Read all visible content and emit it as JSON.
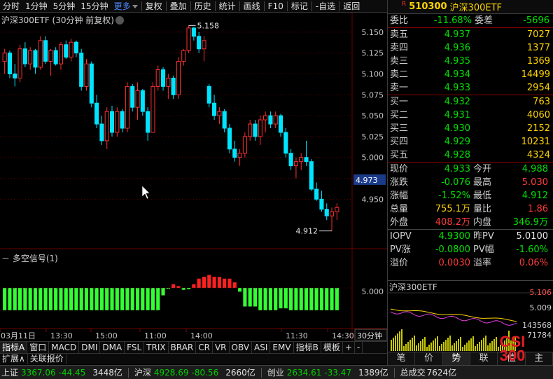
{
  "toolbar": {
    "items": [
      "分时",
      "1分钟",
      "5分钟",
      "15分钟",
      "更多",
      "复权",
      "叠加",
      "历史",
      "统计",
      "画线",
      "F10",
      "标记",
      "-自选",
      "返回"
    ]
  },
  "chart": {
    "title": "沪深300ETF (30分钟 前复权)",
    "y_ticks": [
      "5.150",
      "5.125",
      "5.100",
      "5.075",
      "5.050",
      "5.025",
      "5.000",
      "4.975",
      "4.950"
    ],
    "current_price_tag": "4.973",
    "high_annotation": "5.158",
    "low_annotation": "4.912",
    "x_ticks": [
      "03月11日",
      "13:30",
      "15:00",
      "11:00",
      "14:00",
      "11:30",
      "14:30"
    ],
    "period_label": "30分钟",
    "colors": {
      "up": "#ff3030",
      "down": "#00e5ff",
      "signal_up": "#ff2020",
      "signal_down": "#33ff33"
    }
  },
  "chart_data": {
    "type": "candlestick",
    "title": "沪深300ETF (30分钟 前复权)",
    "ylim": [
      4.905,
      5.165
    ],
    "candles": [
      [
        5.115,
        5.13,
        5.1,
        5.125
      ],
      [
        5.125,
        5.128,
        5.095,
        5.1
      ],
      [
        5.1,
        5.112,
        5.085,
        5.095
      ],
      [
        5.095,
        5.135,
        5.09,
        5.13
      ],
      [
        5.13,
        5.138,
        5.108,
        5.112
      ],
      [
        5.112,
        5.132,
        5.105,
        5.128
      ],
      [
        5.128,
        5.13,
        5.1,
        5.108
      ],
      [
        5.108,
        5.145,
        5.105,
        5.14
      ],
      [
        5.14,
        5.145,
        5.112,
        5.115
      ],
      [
        5.115,
        5.13,
        5.098,
        5.128
      ],
      [
        5.128,
        5.132,
        5.11,
        5.112
      ],
      [
        5.112,
        5.138,
        5.105,
        5.135
      ],
      [
        5.135,
        5.14,
        5.118,
        5.12
      ],
      [
        5.12,
        5.142,
        5.115,
        5.138
      ],
      [
        5.138,
        5.14,
        5.12,
        5.125
      ],
      [
        5.125,
        5.13,
        5.08,
        5.085
      ],
      [
        5.085,
        5.118,
        5.08,
        5.112
      ],
      [
        5.112,
        5.115,
        5.06,
        5.065
      ],
      [
        5.065,
        5.075,
        5.035,
        5.04
      ],
      [
        5.04,
        5.05,
        5.015,
        5.02
      ],
      [
        5.02,
        5.06,
        5.01,
        5.055
      ],
      [
        5.055,
        5.062,
        5.025,
        5.03
      ],
      [
        5.03,
        5.06,
        5.025,
        5.055
      ],
      [
        5.055,
        5.058,
        5.03,
        5.035
      ],
      [
        5.035,
        5.09,
        5.03,
        5.085
      ],
      [
        5.085,
        5.088,
        5.055,
        5.06
      ],
      [
        5.06,
        5.09,
        5.045,
        5.08
      ],
      [
        5.08,
        5.082,
        5.05,
        5.055
      ],
      [
        5.055,
        5.06,
        5.02,
        5.03
      ],
      [
        5.03,
        5.09,
        5.03,
        5.085
      ],
      [
        5.085,
        5.11,
        5.08,
        5.105
      ],
      [
        5.105,
        5.108,
        5.08,
        5.085
      ],
      [
        5.085,
        5.1,
        5.07,
        5.095
      ],
      [
        5.095,
        5.098,
        5.07,
        5.075
      ],
      [
        5.075,
        5.12,
        5.07,
        5.115
      ],
      [
        5.115,
        5.13,
        5.11,
        5.128
      ],
      [
        5.128,
        5.158,
        5.125,
        5.155
      ],
      [
        5.155,
        5.156,
        5.14,
        5.145
      ],
      [
        5.145,
        5.15,
        5.125,
        5.13
      ],
      [
        5.13,
        5.145,
        5.115,
        5.14
      ],
      [
        5.085,
        5.088,
        5.06,
        5.065
      ],
      [
        5.065,
        5.075,
        5.045,
        5.05
      ],
      [
        5.05,
        5.06,
        5.04,
        5.055
      ],
      [
        5.055,
        5.058,
        5.03,
        5.035
      ],
      [
        5.035,
        5.04,
        5.005,
        5.01
      ],
      [
        5.01,
        5.02,
        4.995,
        5.0
      ],
      [
        5.0,
        5.01,
        4.99,
        5.005
      ],
      [
        5.005,
        5.03,
        5.0,
        5.025
      ],
      [
        5.025,
        5.045,
        5.02,
        5.04
      ],
      [
        5.04,
        5.045,
        5.02,
        5.025
      ],
      [
        5.025,
        5.05,
        5.015,
        5.045
      ],
      [
        5.045,
        5.055,
        5.03,
        5.05
      ],
      [
        5.05,
        5.055,
        5.035,
        5.04
      ],
      [
        5.04,
        5.055,
        5.035,
        5.05
      ],
      [
        5.05,
        5.052,
        5.025,
        5.03
      ],
      [
        5.03,
        5.035,
        5.0,
        5.005
      ],
      [
        5.005,
        5.01,
        4.985,
        4.99
      ],
      [
        4.99,
        5.0,
        4.975,
        4.995
      ],
      [
        4.995,
        5.005,
        4.985,
        5.0
      ],
      [
        5.0,
        5.02,
        4.99,
        4.995
      ],
      [
        4.995,
        4.998,
        4.96,
        4.962
      ],
      [
        4.962,
        4.97,
        4.948,
        4.95
      ],
      [
        4.95,
        4.96,
        4.935,
        4.938
      ],
      [
        4.938,
        4.945,
        4.925,
        4.93
      ],
      [
        4.93,
        4.94,
        4.912,
        4.935
      ],
      [
        4.935,
        4.945,
        4.925,
        4.94
      ]
    ],
    "signal": [
      -6,
      -6,
      -6,
      -6,
      -6,
      -6,
      -6,
      -6,
      -6,
      -6,
      -6,
      -6,
      -6,
      -6,
      -6,
      -6,
      -6,
      -6,
      -6,
      -6,
      -6,
      -6,
      -6,
      -6,
      -6,
      -6,
      -6,
      -6,
      -6,
      -6,
      -6,
      -2,
      0,
      1,
      0.5,
      -0.5,
      -0.3,
      1,
      2.5,
      3,
      3.5,
      3,
      3,
      2.5,
      2.5,
      1.5,
      -1,
      -5,
      -5,
      -5,
      -6,
      -6,
      -6,
      -6,
      -5.5,
      -5.5,
      -6,
      -6,
      -6,
      -6,
      -6,
      -6,
      -6,
      -6,
      -6,
      -6
    ],
    "signal_level_label": "5.000"
  },
  "indicator": {
    "title": "多空信号(1)"
  },
  "tabs_row1": [
    "指标A",
    "窗口",
    "MACD",
    "DMI",
    "DMA",
    "FSL",
    "TRIX",
    "BRAR",
    "CR",
    "VR",
    "OBV",
    "ASI",
    "EMV",
    "指标B",
    "模板",
    "+",
    "-"
  ],
  "tabs_row2": [
    "扩展∧",
    "关联报价"
  ],
  "status": {
    "sh_label": "上证",
    "sh_value": "3367.06",
    "sh_change": "-44.45",
    "sh_amount": "3448亿",
    "hs_label": "沪深",
    "hs_value": "4928.69",
    "hs_change": "-80.56",
    "hs_amount": "2660亿",
    "cy_label": "创业",
    "cy_value": "2634.61",
    "cy_change": "-33.47",
    "cy_amount": "1389亿",
    "total_label": "总成交",
    "total_value": "7624亿"
  },
  "quote": {
    "r_mark": "R",
    "code": "510300",
    "name": "沪深300ETF",
    "weibi_label": "委比",
    "weibi_value": "-11.68%",
    "weicha_label": "委差",
    "weicha_value": "-5696",
    "asks": [
      {
        "label": "卖五",
        "price": "4.937",
        "vol": "7027"
      },
      {
        "label": "卖四",
        "price": "4.936",
        "vol": "1377"
      },
      {
        "label": "卖三",
        "price": "4.935",
        "vol": "1369"
      },
      {
        "label": "卖二",
        "price": "4.934",
        "vol": "14499"
      },
      {
        "label": "卖一",
        "price": "4.933",
        "vol": "2954"
      }
    ],
    "bids": [
      {
        "label": "买一",
        "price": "4.932",
        "vol": "763"
      },
      {
        "label": "买二",
        "price": "4.931",
        "vol": "4060"
      },
      {
        "label": "买三",
        "price": "4.930",
        "vol": "2152"
      },
      {
        "label": "买四",
        "price": "4.929",
        "vol": "10231"
      },
      {
        "label": "买五",
        "price": "4.928",
        "vol": "4324"
      }
    ],
    "stats": [
      {
        "k1": "现价",
        "v1": "4.933",
        "c1": "green",
        "k2": "今开",
        "v2": "4.988",
        "c2": "green"
      },
      {
        "k1": "涨跌",
        "v1": "-0.076",
        "c1": "green",
        "k2": "最高",
        "v2": "5.030",
        "c2": "red"
      },
      {
        "k1": "涨幅",
        "v1": "-1.52%",
        "c1": "green",
        "k2": "最低",
        "v2": "4.912",
        "c2": "green"
      },
      {
        "k1": "总量",
        "v1": "755.1万",
        "c1": "yellow",
        "k2": "量比",
        "v2": "1.86",
        "c2": "red"
      },
      {
        "k1": "外盘",
        "v1": "408.2万",
        "c1": "red",
        "k2": "内盘",
        "v2": "346.9万",
        "c2": "green"
      }
    ],
    "iopv": [
      {
        "k1": "IOPV",
        "v1": "4.9300",
        "c1": "green",
        "k2": "昨PV",
        "v2": "5.0100",
        "c2": "white"
      },
      {
        "k1": "PV涨",
        "v1": "-0.0800",
        "c1": "green",
        "k2": "PV幅",
        "v2": "-1.60%",
        "c2": "green"
      },
      {
        "k1": "溢价",
        "v1": "0.0030",
        "c1": "red",
        "k2": "溢率",
        "v2": "0.06%",
        "c2": "red"
      }
    ]
  },
  "mini": {
    "title": "沪深300ETF",
    "price_hi": "5.106",
    "price_mid": "5.009",
    "vol_hi": "143568",
    "vol_lo": "71784"
  },
  "bottom_tabs": [
    "笔",
    "价",
    "势",
    "联",
    "值",
    "主"
  ],
  "logo_text": "CSI 300"
}
